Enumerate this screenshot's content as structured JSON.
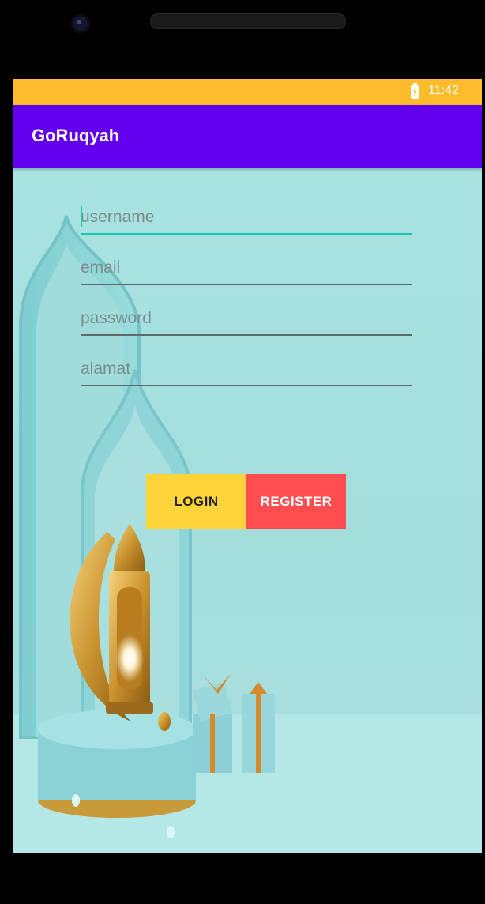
{
  "status_bar": {
    "time": "11:42",
    "icon": "battery-charging-icon"
  },
  "app_bar": {
    "title": "GoRuqyah"
  },
  "form": {
    "username": {
      "placeholder": "username",
      "value": ""
    },
    "email": {
      "placeholder": "email",
      "value": ""
    },
    "password": {
      "placeholder": "password",
      "value": ""
    },
    "alamat": {
      "placeholder": "alamat",
      "value": ""
    },
    "login_label": "LOGIN",
    "register_label": "REGISTER"
  },
  "colors": {
    "status_bar": "#fbbb2a",
    "app_bar": "#6200ee",
    "accent": "#1cc6b4",
    "login_button": "#ffd43b",
    "register_button": "#ff4d4f",
    "background": "#a5e0de"
  }
}
